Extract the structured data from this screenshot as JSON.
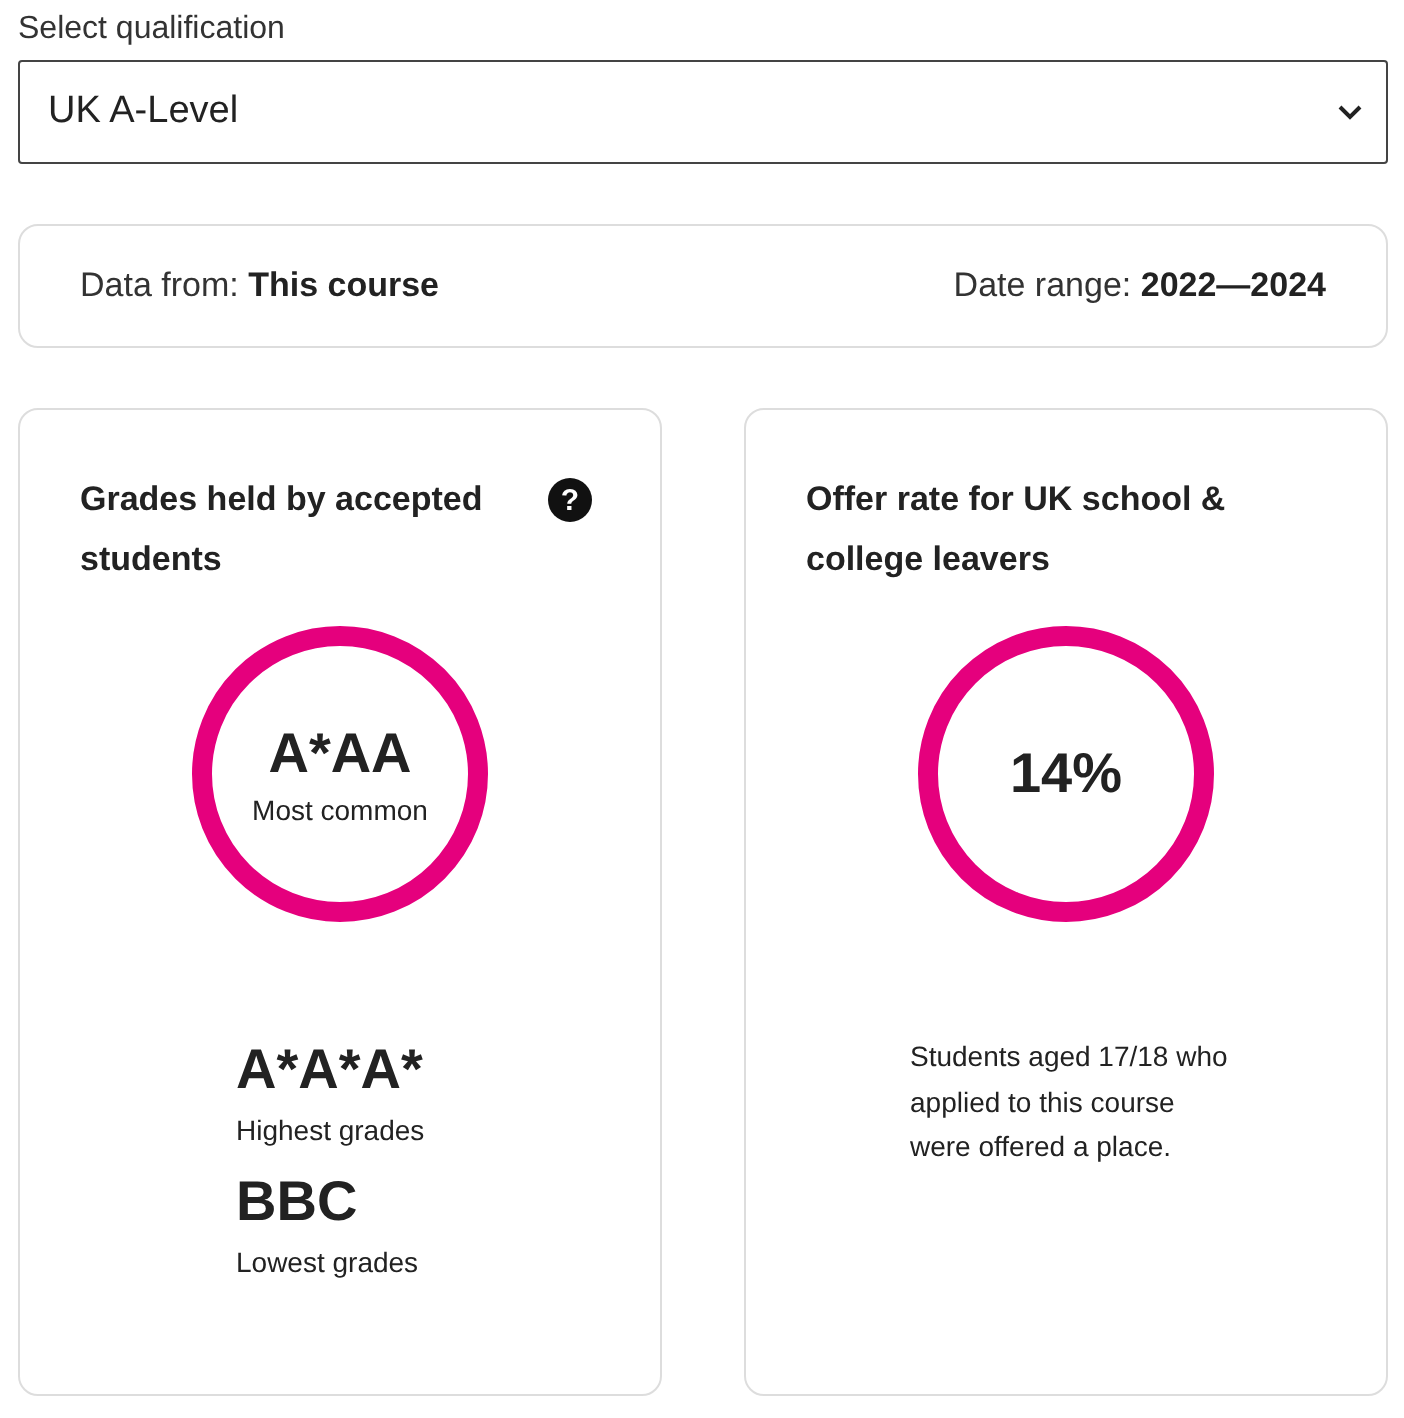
{
  "qualification": {
    "label": "Select qualification",
    "value": "UK A-Level"
  },
  "info": {
    "data_from_label": "Data from:",
    "data_from_value": "This course",
    "date_range_label": "Date range:",
    "date_range_value": "2022—2024"
  },
  "cards": [
    {
      "kind": "grades",
      "title": "Grades held by accepted students",
      "help": "?",
      "main": "A*AA",
      "main_caption": "Most common",
      "highest": "A*A*A*",
      "highest_caption": "Highest grades",
      "lowest": "BBC",
      "lowest_caption": "Lowest grades"
    },
    {
      "kind": "offer",
      "title": "Offer rate for UK school & college leavers",
      "main": "14%",
      "description": "Students aged 17/18 who applied to this course were offered a place."
    }
  ]
}
